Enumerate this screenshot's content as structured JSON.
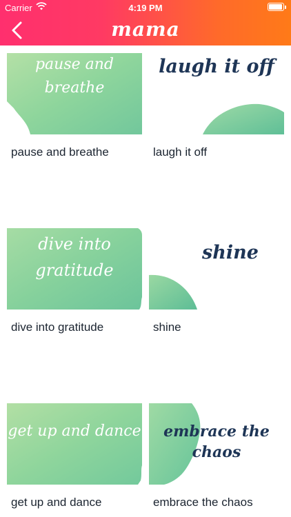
{
  "status_bar": {
    "carrier": "Carrier",
    "time": "4:19 PM"
  },
  "nav": {
    "title": "mama"
  },
  "items": [
    {
      "image_text": "pause and breathe",
      "label": "pause and breathe"
    },
    {
      "image_text": "laugh it off",
      "label": "laugh it off"
    },
    {
      "image_text": "dive into gratitude",
      "label": "dive into gratitude"
    },
    {
      "image_text": "shine",
      "label": "shine"
    },
    {
      "image_text": "get up and dance",
      "label": "get up and dance"
    },
    {
      "image_text": "embrace the chaos",
      "label": "embrace the chaos"
    }
  ],
  "colors": {
    "gradient_start": "#ff2f6e",
    "gradient_end": "#ff7a18",
    "navy_text": "#1e3556",
    "wash_green": "#86d29a"
  }
}
